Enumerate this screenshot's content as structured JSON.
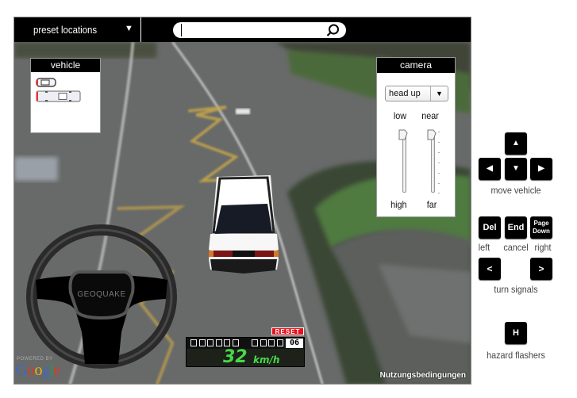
{
  "topbar": {
    "preset_label": "preset locations",
    "preset_caret": "▼",
    "search_value": "",
    "search_placeholder": ""
  },
  "vehicle_panel": {
    "title": "vehicle",
    "options": [
      "sedan",
      "limousine"
    ]
  },
  "camera_panel": {
    "title": "camera",
    "mode_selected": "head up",
    "mode_arrow": "▼",
    "height_slider": {
      "top_label": "low",
      "bottom_label": "high",
      "value": 0.0
    },
    "distance_slider": {
      "top_label": "near",
      "bottom_label": "far",
      "value": 0.0
    }
  },
  "steering_wheel": {
    "brand": "GEOQUAKE"
  },
  "speedometer": {
    "reset_label": "RESET",
    "odometer_digits": [
      "",
      "",
      "",
      "",
      "",
      ""
    ],
    "trip_digits": [
      "",
      "",
      "",
      ""
    ],
    "trip_value": "06",
    "speed": "32",
    "unit": "km/h"
  },
  "attribution": {
    "powered_by": "POWERED BY",
    "google": [
      "G",
      "o",
      "o",
      "g",
      "l",
      "e"
    ],
    "google_colors": [
      "#3469d6",
      "#d93a2c",
      "#f1b500",
      "#3469d6",
      "#2c9a3c",
      "#d93a2c"
    ],
    "terms": "Nutzungsbedingungen"
  },
  "controls": {
    "move": {
      "up": "▲",
      "left": "◀",
      "down": "▼",
      "right": "▶",
      "label": "move vehicle"
    },
    "signals": {
      "del": "Del",
      "end": "End",
      "pagedown_1": "Page",
      "pagedown_2": "Down",
      "left_label": "left",
      "cancel_label": "cancel",
      "right_label": "right",
      "lt": "<",
      "gt": ">",
      "label": "turn signals"
    },
    "hazard": {
      "key": "H",
      "label": "hazard flashers"
    }
  },
  "colors": {
    "speed_green": "#48d848",
    "reset_red": "#e8101a"
  }
}
